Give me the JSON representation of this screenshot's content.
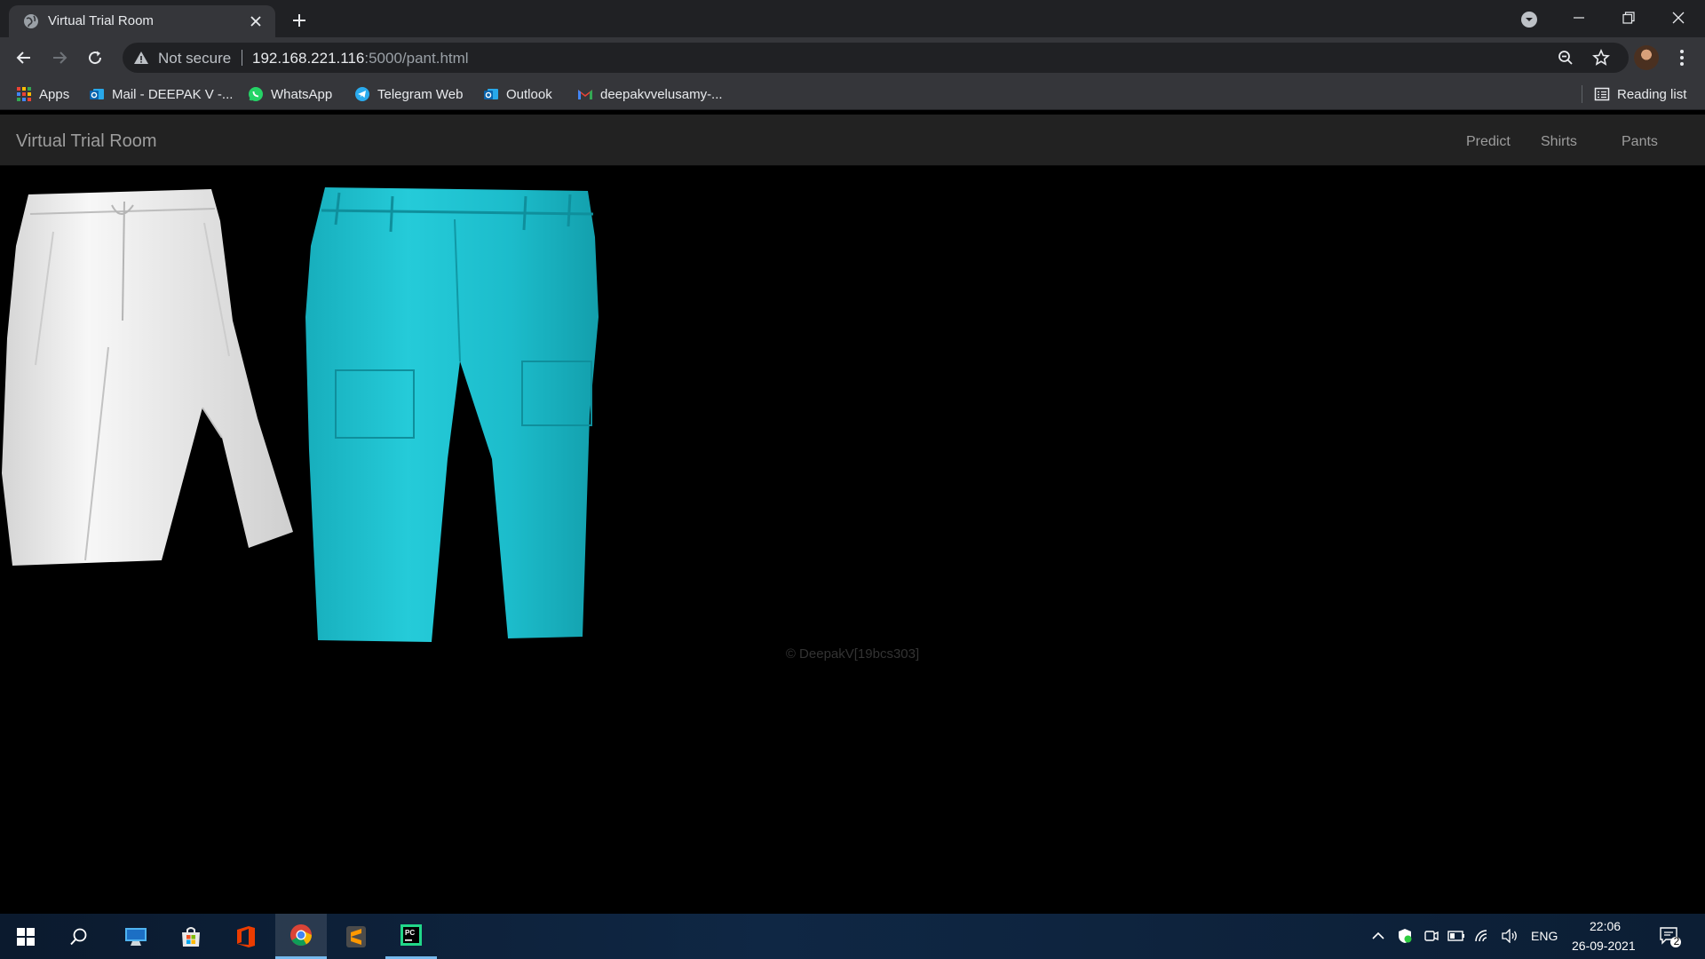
{
  "browser": {
    "tab": {
      "title": "Virtual Trial Room"
    },
    "omnibox": {
      "security_label": "Not secure",
      "url_host": "192.168.221.116",
      "url_path": ":5000/pant.html"
    },
    "bookmarks": [
      {
        "label": "Apps",
        "icon": "apps-grid-icon"
      },
      {
        "label": "Mail - DEEPAK V -...",
        "icon": "outlook-icon"
      },
      {
        "label": "WhatsApp",
        "icon": "whatsapp-icon"
      },
      {
        "label": "Telegram Web",
        "icon": "telegram-icon"
      },
      {
        "label": "Outlook",
        "icon": "outlook-icon"
      },
      {
        "label": "deepakvvelusamy-...",
        "icon": "gmail-icon"
      }
    ],
    "reading_list": "Reading list"
  },
  "site": {
    "brand": "Virtual Trial Room",
    "nav": [
      "Predict",
      "Shirts",
      "Pants"
    ],
    "products": [
      {
        "name": "white-pants",
        "color": "#efefef"
      },
      {
        "name": "cyan-pants",
        "color": "#1fc0cf"
      }
    ],
    "footer": "© DeepakV[19bcs303]"
  },
  "taskbar": {
    "apps": [
      "start-icon",
      "search-icon",
      "this-pc-icon",
      "microsoft-store-icon",
      "office-icon",
      "chrome-icon",
      "sublime-text-icon",
      "pycharm-icon"
    ],
    "language": "ENG",
    "time": "22:06",
    "date": "26-09-2021",
    "notification_count": "2"
  },
  "colors": {
    "chrome_dark": "#202124",
    "chrome_toolbar": "#35363a",
    "navbar_bg": "#222222",
    "page_bg": "#000000",
    "taskbar_accent": "#76b9ed"
  }
}
